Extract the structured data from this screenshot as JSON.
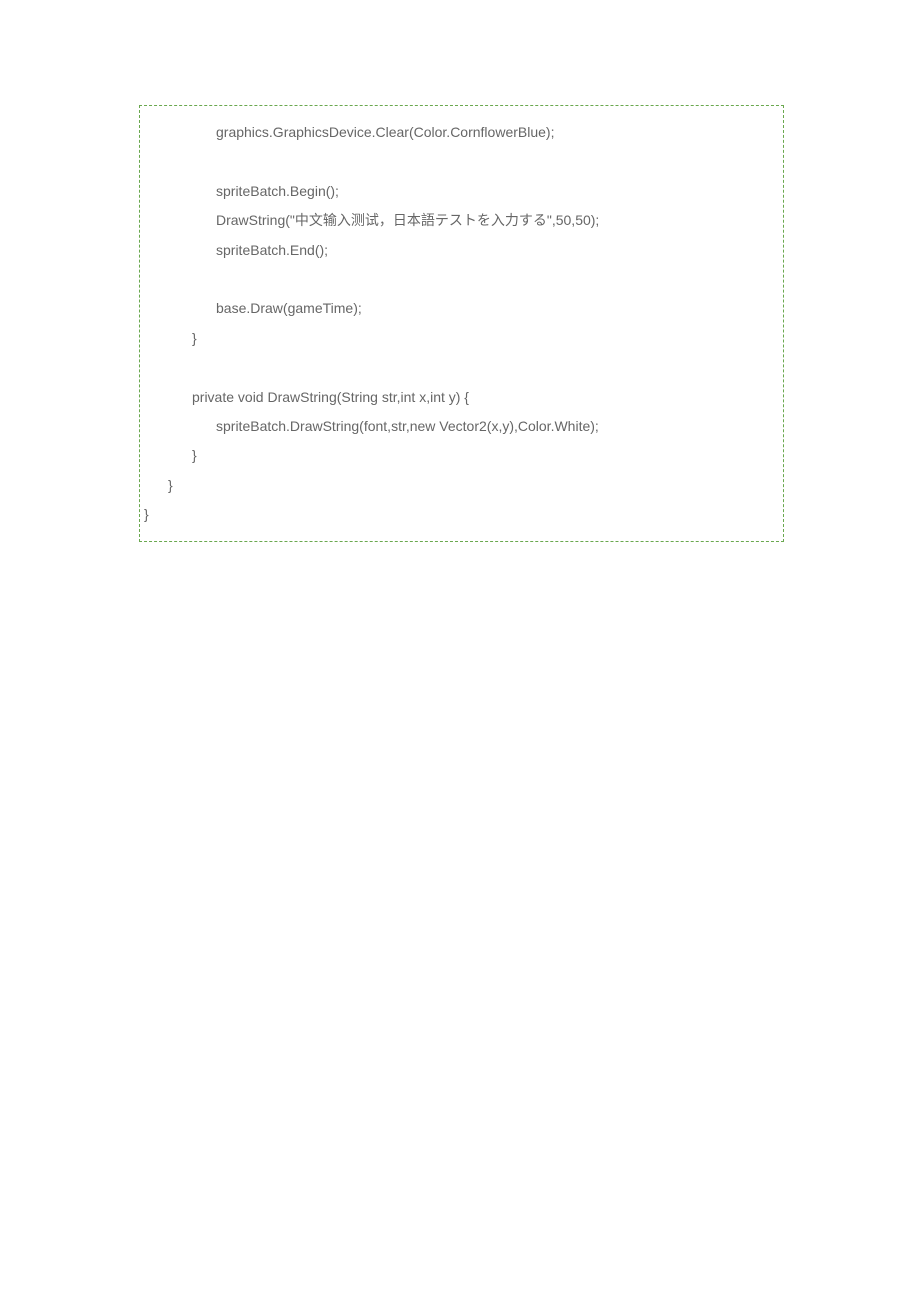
{
  "code": {
    "lines": [
      {
        "indent": 3,
        "text": "graphics.GraphicsDevice.Clear(Color.CornflowerBlue);"
      },
      {
        "indent": 3,
        "text": ""
      },
      {
        "indent": 3,
        "text": "spriteBatch.Begin();"
      },
      {
        "indent": 3,
        "text": "DrawString(\"中文输入测试，日本語テストを入力する\",50,50);"
      },
      {
        "indent": 3,
        "text": "spriteBatch.End();"
      },
      {
        "indent": 3,
        "text": ""
      },
      {
        "indent": 3,
        "text": "base.Draw(gameTime);"
      },
      {
        "indent": 2,
        "text": "}"
      },
      {
        "indent": 2,
        "text": ""
      },
      {
        "indent": 2,
        "text": "private void DrawString(String str,int x,int y) {"
      },
      {
        "indent": 3,
        "text": "spriteBatch.DrawString(font,str,new Vector2(x,y),Color.White);"
      },
      {
        "indent": 2,
        "text": "}"
      },
      {
        "indent": 1,
        "text": "}"
      },
      {
        "indent": 0,
        "text": "}"
      }
    ]
  }
}
